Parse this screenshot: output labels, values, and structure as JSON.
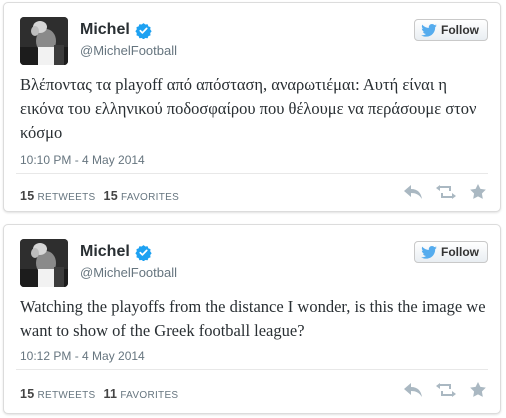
{
  "tweets": [
    {
      "display_name": "Michel",
      "handle": "@MichelFootball",
      "follow_label": "Follow",
      "text": "Βλέποντας τα playoff από απόσταση, αναρωτιέμαι: Αυτή είναι η εικόνα του ελληνικού ποδοσφαίρου που θέλουμε να περάσουμε στον κόσμο",
      "timestamp": "10:10 PM - 4 May 2014",
      "retweets_count": "15",
      "retweets_label": "RETWEETS",
      "favorites_count": "15",
      "favorites_label": "FAVORITES",
      "icons": [
        "verified-icon",
        "twitter-bird-icon",
        "reply-icon",
        "retweet-icon",
        "favorite-star-icon"
      ]
    },
    {
      "display_name": "Michel",
      "handle": "@MichelFootball",
      "follow_label": "Follow",
      "text": "Watching the playoffs from the distance I wonder, is this the image we want to show of the Greek football league?",
      "timestamp": "10:12 PM - 4 May 2014",
      "retweets_count": "15",
      "retweets_label": "RETWEETS",
      "favorites_count": "11",
      "favorites_label": "FAVORITES",
      "icons": [
        "verified-icon",
        "twitter-bird-icon",
        "reply-icon",
        "retweet-icon",
        "favorite-star-icon"
      ]
    }
  ],
  "colors": {
    "verified": "#1da1f2",
    "twitter_blue": "#55acee",
    "text": "#292f33",
    "muted": "#66757f",
    "action_icons": "#aab8c2"
  }
}
